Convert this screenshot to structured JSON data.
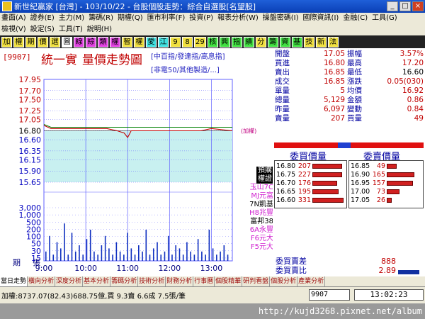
{
  "window": {
    "title": "新世紀贏家 [台灣] - 103/10/22 - 台股個股走勢：綜合自選股[名望股]"
  },
  "menu": {
    "row1": [
      "畫面(A)",
      "證券(E)",
      "主力(M)",
      "籌碼(R)",
      "期權(Q)",
      "匯市利率(F)",
      "投資(P)",
      "報表分析(W)",
      "操盤密碼(I)",
      "國際資訊(I)",
      "金融(C)",
      "工具(G)"
    ],
    "row2": [
      "檢視(V)",
      "設定(S)",
      "工具(T)",
      "說明(H)"
    ]
  },
  "toolbar": {
    "buttons": [
      {
        "label": "加",
        "bg": "#f0e040"
      },
      {
        "label": "權",
        "bg": "#f0e040"
      },
      {
        "label": "期",
        "bg": "#f0e040"
      },
      {
        "label": "價",
        "bg": "#f0e040"
      },
      {
        "label": "選",
        "bg": "#f0e040"
      },
      {
        "label": "圖",
        "bg": "#ffffff"
      },
      {
        "label": "線",
        "bg": "#e040e0"
      },
      {
        "label": "綜",
        "bg": "#e040e0"
      },
      {
        "label": "類",
        "bg": "#e040e0"
      },
      {
        "label": "權",
        "bg": "#e040e0"
      },
      {
        "label": "智",
        "bg": "#f0e040"
      },
      {
        "label": "權",
        "bg": "#f0e040"
      },
      {
        "label": "愛",
        "bg": "#40e0e0"
      },
      {
        "label": "江",
        "bg": "#40e0e0"
      },
      {
        "label": "9",
        "bg": "#f0e040"
      },
      {
        "label": "8",
        "bg": "#f0e040"
      },
      {
        "label": "29",
        "bg": "#f0e040"
      },
      {
        "label": "核",
        "bg": "#40e040"
      },
      {
        "label": "興",
        "bg": "#40e040"
      },
      {
        "label": "指",
        "bg": "#40e040"
      },
      {
        "label": "績",
        "bg": "#40e040"
      },
      {
        "label": "分",
        "bg": "#f0e040"
      },
      {
        "label": "籌",
        "bg": "#40e040"
      },
      {
        "label": "資",
        "bg": "#40e040"
      },
      {
        "label": "基",
        "bg": "#40e040"
      },
      {
        "label": "技",
        "bg": "#f0e040"
      },
      {
        "label": "新",
        "bg": "#f0e040"
      },
      {
        "label": "法",
        "bg": "#f0e040"
      }
    ]
  },
  "header": {
    "code": "[9907]",
    "name": "統一實",
    "chart_title": "量價走勢圖",
    "indices_line1": "[中百指/發達指/高息指]",
    "indices_line2": "[非電50/其他製造/...]"
  },
  "chart_labels": {
    "price_ticks": [
      "17.95",
      "17.70",
      "17.50",
      "17.25",
      "17.05",
      "16.80",
      "16.60",
      "16.35",
      "16.15",
      "15.90",
      "15.65"
    ],
    "volume_ticks": [
      "3,000",
      "1,000",
      "500",
      "200",
      "100",
      "50",
      "30",
      "15"
    ],
    "time_ticks": [
      "9:00",
      "10:00",
      "11:00",
      "12:00",
      "13:00"
    ],
    "volume_axis_label_1": "期",
    "volume_axis_label_2": "張",
    "ref_tag": "(加權)"
  },
  "chart_data": {
    "type": "line",
    "price": {
      "x": [
        "9:00",
        "9:10",
        "9:30",
        "9:45",
        "10:00",
        "10:30",
        "10:45",
        "10:55",
        "11:00",
        "11:05",
        "11:15",
        "11:30",
        "12:00",
        "12:30",
        "12:45",
        "13:00",
        "13:30"
      ],
      "y": [
        16.92,
        16.85,
        16.85,
        16.85,
        16.85,
        16.85,
        16.8,
        16.75,
        16.65,
        16.8,
        16.8,
        16.8,
        16.8,
        16.8,
        16.8,
        16.85,
        16.8
      ],
      "ylim": [
        15.65,
        17.95
      ],
      "reference": 16.8
    },
    "volume": {
      "values": [
        3,
        8,
        2,
        6,
        4,
        12,
        2,
        9,
        3,
        5,
        2,
        7,
        10,
        3,
        2,
        5,
        8,
        4,
        2,
        6,
        3,
        2,
        9,
        4,
        2,
        5,
        3,
        10,
        2,
        4,
        6,
        2,
        3,
        8,
        2,
        5,
        4,
        2,
        6,
        3,
        2,
        7,
        3,
        2,
        10,
        4,
        2,
        3,
        5,
        2
      ],
      "ylim": [
        0,
        15
      ]
    }
  },
  "legend": [
    {
      "label": "預購",
      "fg": "#ffffff",
      "bg": "#000000"
    },
    {
      "label": "權證",
      "fg": "#ffffff",
      "bg": "#000000"
    },
    {
      "label": "玉山7C",
      "fg": "#d020d0",
      "bg": "transparent"
    },
    {
      "label": "MJ元富",
      "fg": "#d020d0",
      "bg": "transparent"
    },
    {
      "label": "7N凱基",
      "fg": "#000000",
      "bg": "transparent"
    },
    {
      "label": "H8兆豐",
      "fg": "#d020d0",
      "bg": "transparent"
    },
    {
      "label": "富邦38",
      "fg": "#000000",
      "bg": "transparent"
    },
    {
      "label": "6A永豐",
      "fg": "#d020d0",
      "bg": "transparent"
    },
    {
      "label": "F6元大",
      "fg": "#d020d0",
      "bg": "transparent"
    },
    {
      "label": "F5元大",
      "fg": "#d020d0",
      "bg": "transparent"
    }
  ],
  "quotes": [
    {
      "l1": "開盤",
      "v1": "17.05",
      "c1": "#c00000",
      "l2": "振幅",
      "v2": "3.57%",
      "c2": "#c00000"
    },
    {
      "l1": "買進",
      "v1": "16.80",
      "c1": "#c00000",
      "l2": "最高",
      "v2": "17.20",
      "c2": "#c00000"
    },
    {
      "l1": "賣出",
      "v1": "16.85",
      "c1": "#c00000",
      "l2": "最低",
      "v2": "16.60",
      "c2": "#000000"
    },
    {
      "l1": "成交",
      "v1": "16.85",
      "c1": "#c00000",
      "l2": "漲跌",
      "v2": "0.05(030)",
      "c2": "#c00000"
    },
    {
      "l1": "單量",
      "v1": "5",
      "c1": "#c00000",
      "l2": "均價",
      "v2": "16.92",
      "c2": "#c00000"
    },
    {
      "l1": "總量",
      "v1": "5,129",
      "c1": "#c00000",
      "l2": "金額",
      "v2": "0.86",
      "c2": "#c00000"
    },
    {
      "l1": "昨量",
      "v1": "6,097",
      "c1": "#c00000",
      "l2": "變動",
      "v2": "0.84",
      "c2": "#c00000"
    },
    {
      "l1": "賣量",
      "v1": "207",
      "c1": "#c00000",
      "l2": "買量",
      "v2": "49",
      "c2": "#c00000"
    }
  ],
  "orderbook": {
    "bid_header": "委買價量",
    "ask_header": "委賣價量",
    "bids": [
      {
        "price": "16.80",
        "vol": "207",
        "fill": 0.95
      },
      {
        "price": "16.75",
        "vol": "227",
        "fill": 0.95
      },
      {
        "price": "16.70",
        "vol": "176",
        "fill": 0.8
      },
      {
        "price": "16.65",
        "vol": "195",
        "fill": 0.85
      },
      {
        "price": "16.60",
        "vol": "331",
        "fill": 1.0
      }
    ],
    "asks": [
      {
        "price": "16.85",
        "vol": "49",
        "fill": 0.3
      },
      {
        "price": "16.90",
        "vol": "165",
        "fill": 0.85
      },
      {
        "price": "16.95",
        "vol": "157",
        "fill": 0.8
      },
      {
        "price": "17.00",
        "vol": "73",
        "fill": 0.4
      },
      {
        "price": "17.05",
        "vol": "26",
        "fill": 0.15
      }
    ]
  },
  "summary": {
    "diff_label": "委買賣差",
    "diff_value": "888",
    "ratio_label": "委買賣比",
    "ratio_value": "2.89"
  },
  "tabs": [
    "當日走勢",
    "橫向分析",
    "深度分析",
    "基本分析",
    "籌碼分析",
    "技術分析",
    "財務分析",
    "行事曆",
    "個股精華",
    "研判看盤",
    "個股分析",
    "產業分析"
  ],
  "status": {
    "text": "加權:8737.07(82.43)688.75億,買 9.3賣 6.6成 7.5張/筆",
    "code_input": "9907",
    "clock": "13:02:23"
  },
  "watermark": "http://kujd3268.pixnet.net/album",
  "colors": {
    "price_line": "#c00000",
    "avg_line": "#008000",
    "area_fill": "#c8f0f0",
    "volume_bar": "#1030c0",
    "grid": "#6060ff"
  }
}
